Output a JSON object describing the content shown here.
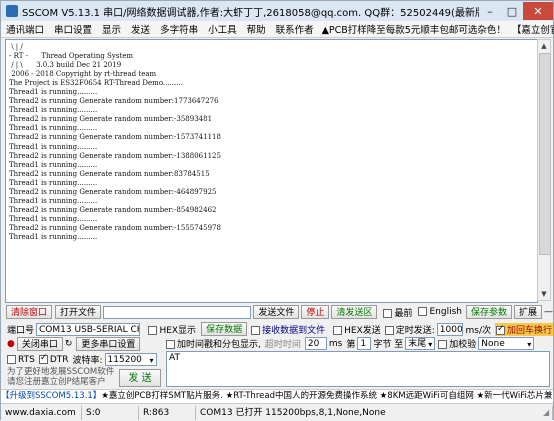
{
  "window": {
    "title": "SSCOM V5.13.1 串口/网络数据调试器,作者:大虾丁丁,2618058@qq.com. QQ群：52502449(最新版本)"
  },
  "menu": {
    "items": [
      "通讯端口",
      "串口设置",
      "显示",
      "发送",
      "多字符串",
      "小工具",
      "帮助",
      "联系作者"
    ],
    "ad1": "▲PCB打样降至每款5元顺丰包邮可选杂色！",
    "ad2": "【嘉立创官网】"
  },
  "terminal": {
    "lines": [
      " \\ | /",
      "- RT -      Thread Operating System",
      " / | \\      3.0.3 build Dec 21 2019",
      " 2006 - 2018 Copyright by rt-thread team",
      "The Project is ES32F0654 RT-Thread Demo.........",
      "Thread1 is running.........",
      "Thread2 is running Generate random number:1773647276",
      "Thread1 is running.........",
      "Thread2 is running Generate random number:-35893481",
      "Thread1 is running.........",
      "Thread2 is running Generate random number:-1573741118",
      "Thread1 is running.........",
      "Thread2 is running Generate random number:-1388061125",
      "Thread1 is running.........",
      "Thread2 is running Generate random number:83784515",
      "Thread1 is running.........",
      "Thread2 is running Generate random number:-464897925",
      "Thread1 is running.........",
      "Thread2 is running Generate random number:-854982462",
      "Thread1 is running.........",
      "Thread2 is running Generate random number:-1555745978",
      "Thread1 is running........."
    ]
  },
  "toolbar1": {
    "clear": "清除窗口",
    "open_file": "打开文件",
    "send_file": "发送文件",
    "stop": "停止",
    "clear_send": "清发送区",
    "topmost": "最前",
    "english": "English",
    "save_params": "保存参数",
    "expand": "扩展",
    "dash": "—"
  },
  "toolbar2": {
    "port_label": "端口号",
    "port_value": "COM13 USB-SERIAL CH340",
    "hex_display": "HEX显示",
    "save_data": "保存数据",
    "recv_to_file": "接收数据到文件",
    "hex_send": "HEX发送",
    "timed_send": "定时发送:",
    "interval": "1000",
    "interval_unit": "ms/次",
    "add_crlf": "加回车换行"
  },
  "toolbar3": {
    "close_port": "关闭串口",
    "more_settings": "更多串口设置",
    "timestamp": "加时间戳和分包显示,",
    "timeout_label": "超时时间",
    "timeout_value": "20",
    "ms": "ms",
    "byte_label_pre": "第",
    "byte_value": "1",
    "byte_label_post": "字节 至",
    "end_value": "末尾",
    "checksum_label": "加校验",
    "checksum_value": "None"
  },
  "toolbar4": {
    "rts": "RTS",
    "dtr": "DTR",
    "baud_label": "波特率:",
    "baud_value": "115200",
    "send_text": "AT"
  },
  "promo": {
    "line1": "为了更好地发展SSCOM软件",
    "line2": "请您注册嘉立创P结尾客户"
  },
  "send_button": "发 送",
  "ticker": {
    "prefix": "【升级到SSCOM5.13.1】",
    "text": "★嘉立创PCB打样SMT贴片服务. ★RT-Thread中国人的开源免费操作系统 ★8KM远距WiFi可自组网 ★新一代WiFi芯片兼容8266支持RT-Thread"
  },
  "status": {
    "site": "www.daxia.com",
    "s": "S:0",
    "r": "R:863",
    "port_status": "COM13 已打开  115200bps,8,1,None,None"
  }
}
